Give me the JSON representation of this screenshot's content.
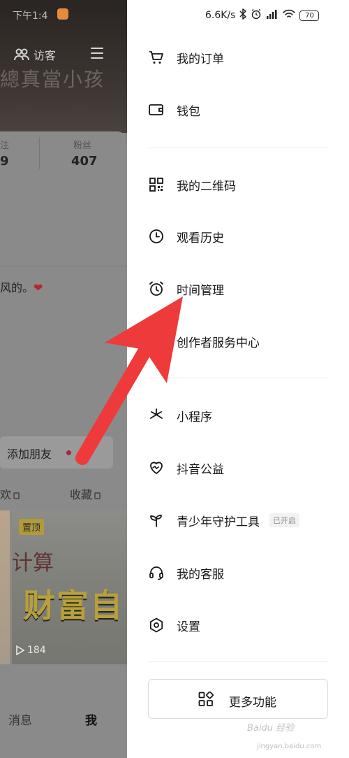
{
  "status_bar": {
    "time": "下午1:4",
    "net_speed": "6.6K/s",
    "battery": "70"
  },
  "background": {
    "visitor_label": "访客",
    "banner_text": "總真當小孩",
    "follow_label": "注",
    "follow_count": "9",
    "fans_label": "粉丝",
    "fans_count": "407",
    "bio": "风的。",
    "add_friend": "添加朋友",
    "tab_likes": "欢",
    "tab_favorites": "收藏",
    "pinned": "置顶",
    "thumb_title": "计算",
    "thumb_big_text": "财富自",
    "views": "184",
    "nav_message": "消息",
    "nav_me": "我"
  },
  "drawer": {
    "items": [
      {
        "label": "我的订单",
        "icon": "cart-icon"
      },
      {
        "label": "钱包",
        "icon": "wallet-icon"
      },
      {
        "label": "我的二维码",
        "icon": "qrcode-icon"
      },
      {
        "label": "观看历史",
        "icon": "clock-icon"
      },
      {
        "label": "时间管理",
        "icon": "alarm-icon"
      },
      {
        "label": "创作者服务中心",
        "icon": "creator-icon"
      },
      {
        "label": "小程序",
        "icon": "mini-program-icon"
      },
      {
        "label": "抖音公益",
        "icon": "charity-heart-icon"
      },
      {
        "label": "青少年守护工具",
        "icon": "sprout-icon",
        "badge": "已开启"
      },
      {
        "label": "我的客服",
        "icon": "headset-icon"
      },
      {
        "label": "设置",
        "icon": "settings-hexagon-icon"
      }
    ],
    "more_button": "更多功能"
  },
  "watermark": {
    "text": "Baidu 经验",
    "sub": "jingyan.baidu.com"
  },
  "colors": {
    "arrow": "#ee3a3a",
    "overlay": "#858585",
    "drawer_bg": "#ffffff"
  }
}
